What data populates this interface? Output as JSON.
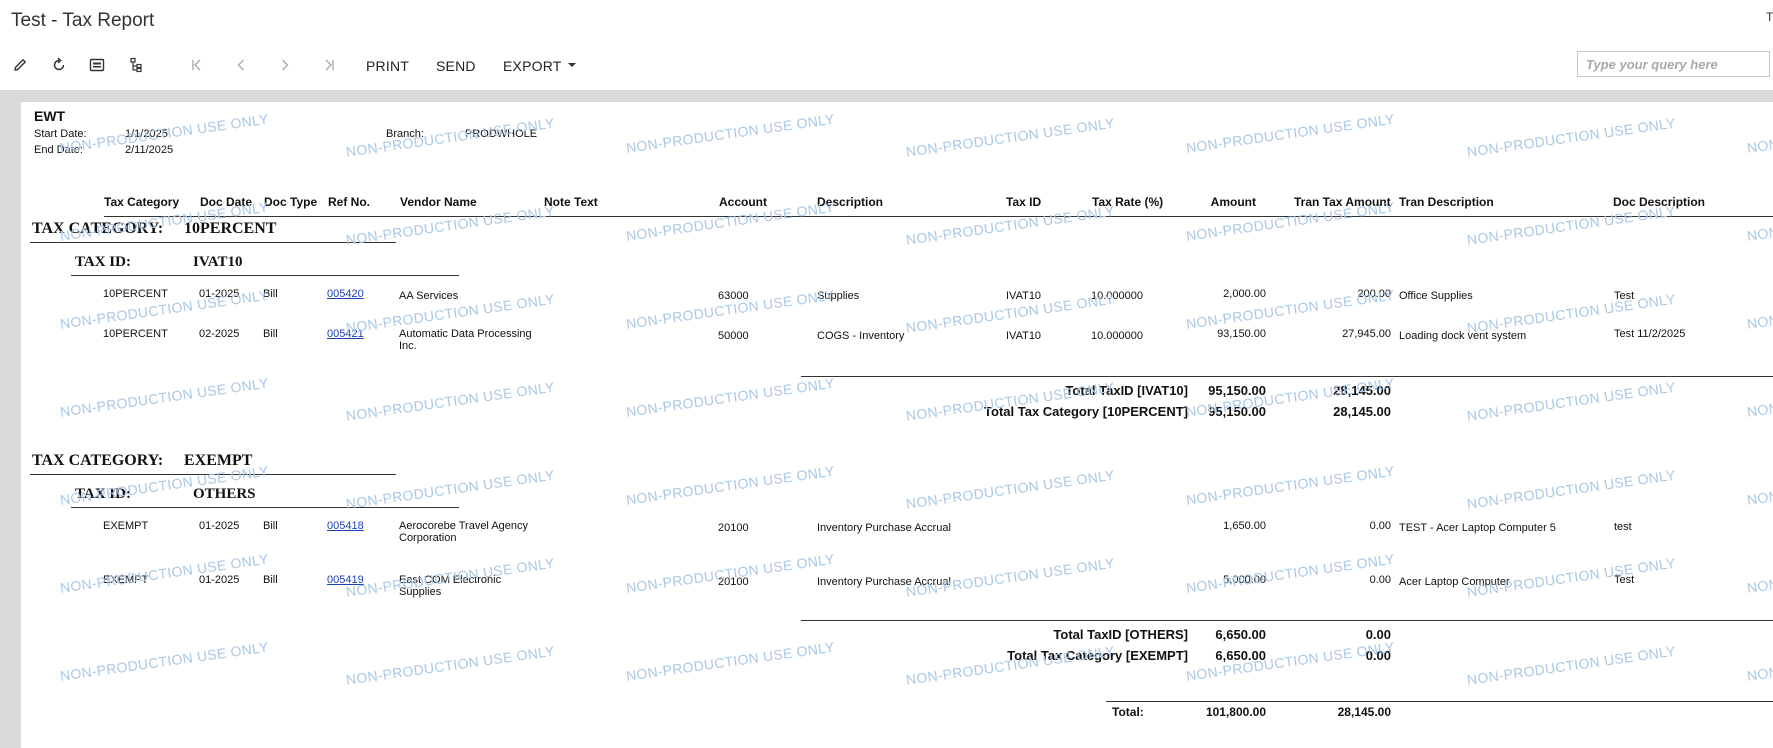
{
  "window": {
    "title": "Test - Tax Report",
    "corner_text": "T"
  },
  "toolbar": {
    "icons": [
      "pencil-icon",
      "refresh-icon",
      "keyboard-icon",
      "tree-icon",
      "first-page-icon",
      "previous-page-icon",
      "next-page-icon",
      "last-page-icon"
    ],
    "print_label": "PRINT",
    "send_label": "SEND",
    "export_label": "EXPORT"
  },
  "search": {
    "placeholder": "Type your query here",
    "value": ""
  },
  "report": {
    "name": "EWT",
    "start_date_label": "Start Date:",
    "start_date": "1/1/2025",
    "end_date_label": "End Date:",
    "end_date": "2/11/2025",
    "branch_label": "Branch:",
    "branch": "PRODWHOLE",
    "columns": {
      "tax_category": "Tax Category",
      "doc_date": "Doc Date",
      "doc_type": "Doc Type",
      "ref_no": "Ref No.",
      "vendor_name": "Vendor Name",
      "note_text": "Note Text",
      "account": "Account",
      "description": "Description",
      "tax_id": "Tax ID",
      "tax_rate": "Tax Rate (%)",
      "amount": "Amount",
      "tran_tax_amount": "Tran Tax Amount",
      "tran_description": "Tran Description",
      "doc_description": "Doc Description"
    },
    "groups": [
      {
        "category_label": "TAX CATEGORY:",
        "category": "10PERCENT",
        "taxid_label": "TAX ID:",
        "taxid": "IVAT10",
        "rows": [
          {
            "tax_category": "10PERCENT",
            "doc_date": "01-2025",
            "doc_type": "Bill",
            "ref_no": "005420",
            "vendor_line1": "AA Services",
            "vendor_line2": "",
            "account": "63000",
            "description": "Supplies",
            "tax_id": "IVAT10",
            "tax_rate": "10.000000",
            "amount": "2,000.00",
            "tran_tax_amount": "200.00",
            "tran_description": "Office Supplies",
            "doc_description": "Test"
          },
          {
            "tax_category": "10PERCENT",
            "doc_date": "02-2025",
            "doc_type": "Bill",
            "ref_no": "005421",
            "vendor_line1": "Automatic Data Processing",
            "vendor_line2": "Inc.",
            "account": "50000",
            "description": "COGS - Inventory",
            "tax_id": "IVAT10",
            "tax_rate": "10.000000",
            "amount": "93,150.00",
            "tran_tax_amount": "27,945.00",
            "tran_description": "Loading dock vent system",
            "doc_description": "Test 11/2/2025"
          }
        ],
        "taxid_total_label": "Total TaxID [IVAT10]",
        "taxid_total_amount": "95,150.00",
        "taxid_total_tax": "28,145.00",
        "category_total_label": "Total Tax Category [10PERCENT]",
        "category_total_amount": "95,150.00",
        "category_total_tax": "28,145.00"
      },
      {
        "category_label": "TAX CATEGORY:",
        "category": "EXEMPT",
        "taxid_label": "TAX ID:",
        "taxid": "OTHERS",
        "rows": [
          {
            "tax_category": "EXEMPT",
            "doc_date": "01-2025",
            "doc_type": "Bill",
            "ref_no": "005418",
            "vendor_line1": "Aerocorebe Travel Agency",
            "vendor_line2": "Corporation",
            "account": "20100",
            "description": "Inventory Purchase Accrual",
            "tax_id": "",
            "tax_rate": "",
            "amount": "1,650.00",
            "tran_tax_amount": "0.00",
            "tran_description": "TEST - Acer Laptop Computer 5",
            "doc_description": "test"
          },
          {
            "tax_category": "EXEMPT",
            "doc_date": "01-2025",
            "doc_type": "Bill",
            "ref_no": "005419",
            "vendor_line1": "East COM Electronic",
            "vendor_line2": "Supplies",
            "account": "20100",
            "description": "Inventory Purchase Accrual",
            "tax_id": "",
            "tax_rate": "",
            "amount": "5,000.00",
            "tran_tax_amount": "0.00",
            "tran_description": "Acer Laptop Computer",
            "doc_description": "Test"
          }
        ],
        "taxid_total_label": "Total TaxID [OTHERS]",
        "taxid_total_amount": "6,650.00",
        "taxid_total_tax": "0.00",
        "category_total_label": "Total Tax Category [EXEMPT]",
        "category_total_amount": "6,650.00",
        "category_total_tax": "0.00"
      }
    ],
    "grand_total_label": "Total:",
    "grand_total_amount": "101,800.00",
    "grand_total_tax": "28,145.00"
  },
  "watermark": {
    "text": "NON-PRODUCTION USE ONLY",
    "color": "#a9c8e6"
  },
  "colors": {
    "link": "#1f3fb5",
    "frame": "#d9d9d9"
  }
}
